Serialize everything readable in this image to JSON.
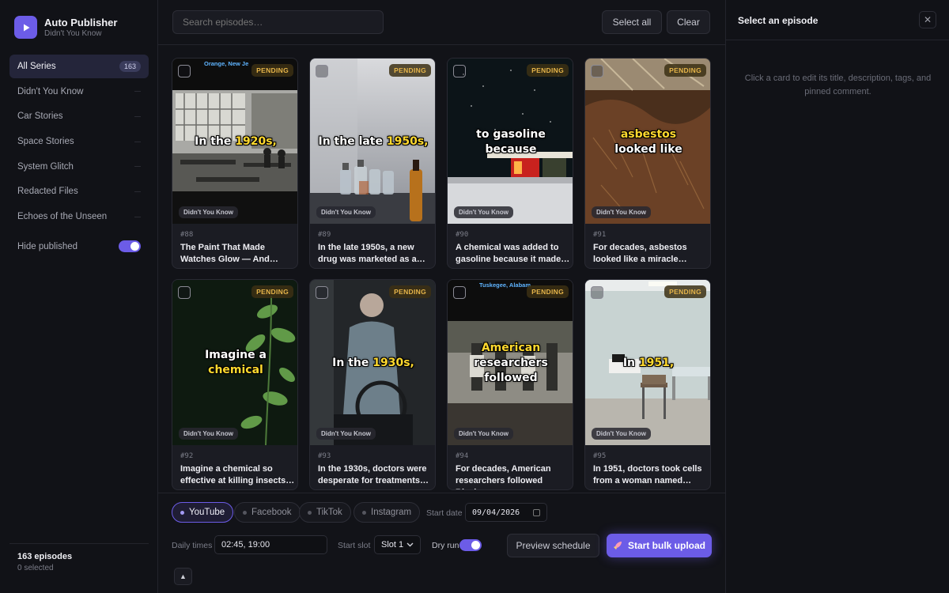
{
  "app": {
    "title": "Auto Publisher",
    "subtitle": "Didn't You Know",
    "accent": "#6c5ce7"
  },
  "sidebar": {
    "items": [
      {
        "label": "All Series",
        "count": "163",
        "active": true
      },
      {
        "label": "Didn't You Know"
      },
      {
        "label": "Car Stories"
      },
      {
        "label": "Space Stories"
      },
      {
        "label": "System Glitch"
      },
      {
        "label": "Redacted Files"
      },
      {
        "label": "Echoes of the Unseen"
      }
    ],
    "hide_published_label": "Hide published",
    "hide_published": true,
    "footer_count": "163 episodes",
    "footer_selected": "0 selected"
  },
  "toolbar": {
    "search_placeholder": "Search episodes…",
    "select_all": "Select all",
    "clear": "Clear"
  },
  "episodes": [
    {
      "num": "#88",
      "title": "The Paint That Made Watches Glow — And…",
      "status": "PENDING",
      "series": "Didn't You Know",
      "caption": "In the",
      "caption_hl": "1920s,",
      "location": "Orange, New Je"
    },
    {
      "num": "#89",
      "title": "In the late 1950s, a new drug was marketed as a…",
      "status": "PENDING",
      "series": "Didn't You Know",
      "caption": "In the late",
      "caption_hl": "1950s,",
      "location": ""
    },
    {
      "num": "#90",
      "title": "A chemical was added to gasoline because it made…",
      "status": "PENDING",
      "series": "Didn't You Know",
      "caption": "to gasoline",
      "caption2": "because",
      "location": ""
    },
    {
      "num": "#91",
      "title": "For decades, asbestos looked like a miracle…",
      "status": "PENDING",
      "series": "Didn't You Know",
      "caption": "asbestos",
      "caption2": "looked like",
      "location": ""
    },
    {
      "num": "#92",
      "title": "Imagine a chemical so effective at killing insects…",
      "status": "PENDING",
      "series": "Didn't You Know",
      "caption": "Imagine a",
      "caption2": "chemical",
      "location": ""
    },
    {
      "num": "#93",
      "title": "In the 1930s, doctors were desperate for treatments…",
      "status": "PENDING",
      "series": "Didn't You Know",
      "caption": "In the",
      "caption_hl": "1930s,",
      "location": ""
    },
    {
      "num": "#94",
      "title": "For decades, American researchers followed Black…",
      "status": "PENDING",
      "series": "Didn't You Know",
      "caption": "American",
      "caption2": "researchers",
      "caption3": "followed",
      "location": "Tuskegee, Alabam"
    },
    {
      "num": "#95",
      "title": "In 1951, doctors took cells from a woman named…",
      "status": "PENDING",
      "series": "Didn't You Know",
      "caption": "In",
      "caption_hl": "1951,",
      "location": ""
    }
  ],
  "platforms": [
    {
      "label": "YouTube",
      "active": true
    },
    {
      "label": "Facebook"
    },
    {
      "label": "TikTok"
    },
    {
      "label": "Instagram"
    }
  ],
  "schedule": {
    "start_date_label": "Start date",
    "start_date": "09/04/2026",
    "daily_times_label": "Daily times",
    "daily_times": "02:45, 19:00",
    "start_slot_label": "Start slot",
    "start_slot": "Slot 1",
    "dry_run_label": "Dry run",
    "dry_run": true,
    "preview": "Preview schedule",
    "start": "Start bulk upload"
  },
  "panel": {
    "title": "Select an episode",
    "hint": "Click a card to edit its title, description, tags, and pinned comment."
  }
}
